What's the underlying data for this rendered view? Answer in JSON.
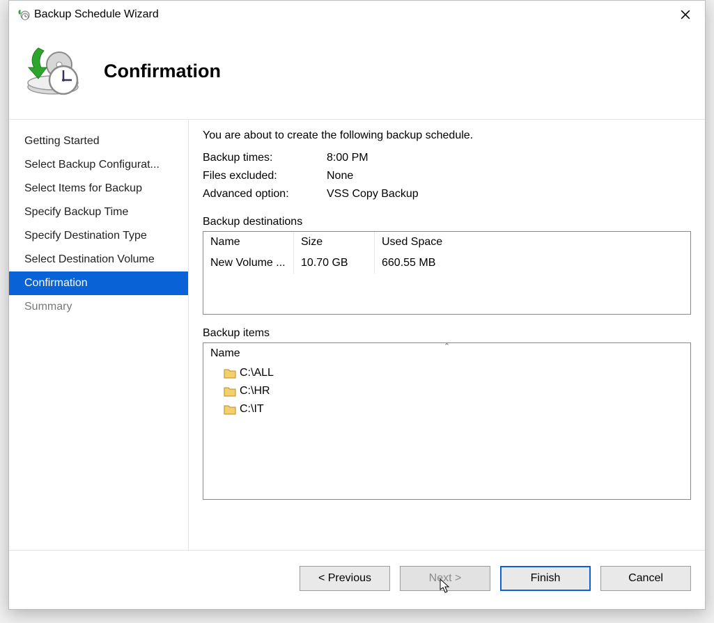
{
  "window": {
    "title": "Backup Schedule Wizard"
  },
  "header": {
    "title": "Confirmation"
  },
  "sidebar": {
    "steps": [
      {
        "label": "Getting Started"
      },
      {
        "label": "Select Backup Configurat..."
      },
      {
        "label": "Select Items for Backup"
      },
      {
        "label": "Specify Backup Time"
      },
      {
        "label": "Specify Destination Type"
      },
      {
        "label": "Select Destination Volume"
      },
      {
        "label": "Confirmation"
      },
      {
        "label": "Summary"
      }
    ],
    "active_index": 6,
    "disabled_index": 7
  },
  "content": {
    "intro": "You are about to create the following backup schedule.",
    "rows": {
      "backup_times": {
        "label": "Backup times:",
        "value": "8:00 PM"
      },
      "files_excluded": {
        "label": "Files excluded:",
        "value": "None"
      },
      "advanced_option": {
        "label": "Advanced option:",
        "value": "VSS Copy Backup"
      }
    },
    "destinations": {
      "label": "Backup destinations",
      "columns": {
        "name": "Name",
        "size": "Size",
        "used": "Used Space"
      },
      "rows": [
        {
          "name": "New Volume ...",
          "size": "10.70 GB",
          "used": "660.55 MB"
        }
      ]
    },
    "items": {
      "label": "Backup items",
      "column": "Name",
      "rows": [
        {
          "path": "C:\\ALL"
        },
        {
          "path": "C:\\HR"
        },
        {
          "path": "C:\\IT"
        }
      ]
    }
  },
  "footer": {
    "previous": "< Previous",
    "next": "Next >",
    "finish": "Finish",
    "cancel": "Cancel"
  }
}
